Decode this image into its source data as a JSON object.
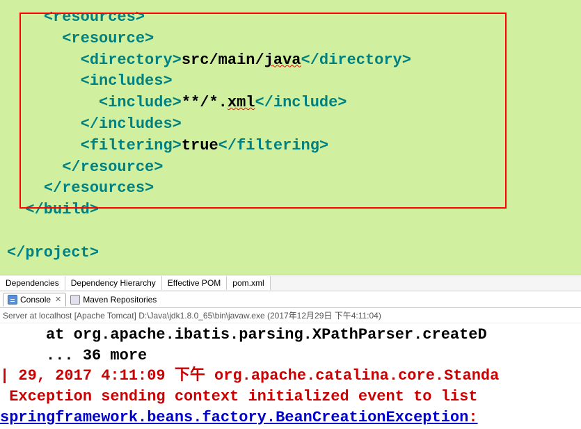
{
  "editor": {
    "lines": [
      {
        "indent": 2,
        "parts": [
          {
            "t": "tag",
            "v": "<resources>"
          }
        ]
      },
      {
        "indent": 3,
        "parts": [
          {
            "t": "tag",
            "v": "<resource>"
          }
        ]
      },
      {
        "indent": 4,
        "parts": [
          {
            "t": "tag",
            "v": "<directory>"
          },
          {
            "t": "txt",
            "v": "src/main/"
          },
          {
            "t": "err",
            "v": "java"
          },
          {
            "t": "tag",
            "v": "</directory>"
          }
        ]
      },
      {
        "indent": 4,
        "parts": [
          {
            "t": "tag",
            "v": "<includes>"
          }
        ]
      },
      {
        "indent": 5,
        "parts": [
          {
            "t": "tag",
            "v": "<include>"
          },
          {
            "t": "txt",
            "v": "**/*."
          },
          {
            "t": "err",
            "v": "xml"
          },
          {
            "t": "tag",
            "v": "</include>"
          }
        ]
      },
      {
        "indent": 4,
        "parts": [
          {
            "t": "tag",
            "v": "</includes>"
          }
        ]
      },
      {
        "indent": 4,
        "parts": [
          {
            "t": "tag",
            "v": "<filtering>"
          },
          {
            "t": "txt",
            "v": "true"
          },
          {
            "t": "tag",
            "v": "</filtering>"
          }
        ]
      },
      {
        "indent": 3,
        "parts": [
          {
            "t": "tag",
            "v": "</resource>"
          }
        ]
      },
      {
        "indent": 2,
        "parts": [
          {
            "t": "tag",
            "v": "</resources>"
          }
        ]
      },
      {
        "indent": 1,
        "parts": [
          {
            "t": "tag",
            "v": "</build>"
          }
        ]
      },
      {
        "indent": 0,
        "parts": [
          {
            "t": "txt",
            "v": " "
          }
        ]
      },
      {
        "indent": 0,
        "parts": [
          {
            "t": "tag",
            "v": "</project>"
          }
        ]
      }
    ]
  },
  "bottom_tabs": [
    "Dependencies",
    "Dependency Hierarchy",
    "Effective POM",
    "pom.xml"
  ],
  "panel_tabs": [
    {
      "label": "Console",
      "active": true,
      "closable": true
    },
    {
      "label": "Maven Repositories",
      "active": false,
      "closable": false
    }
  ],
  "server_info": "Server at localhost [Apache Tomcat] D:\\Java\\jdk1.8.0_65\\bin\\javaw.exe (2017年12月29日 下午4:11:04)",
  "console": {
    "lines": [
      {
        "cls": "con-black",
        "indent": "     ",
        "v": "at org.apache.ibatis.parsing.XPathParser.createD"
      },
      {
        "cls": "con-black",
        "indent": "     ",
        "v": "... 36 more"
      },
      {
        "cls": "con-red",
        "indent": "",
        "v": "| 29, 2017 4:11:09 下午 org.apache.catalina.core.Standa"
      },
      {
        "cls": "con-red",
        "indent": "",
        "v": " Exception sending context initialized event to list"
      },
      {
        "cls": "con-blue",
        "indent": "",
        "v": "springframework.beans.factory.BeanCreationException",
        "suffix": ":"
      }
    ]
  }
}
